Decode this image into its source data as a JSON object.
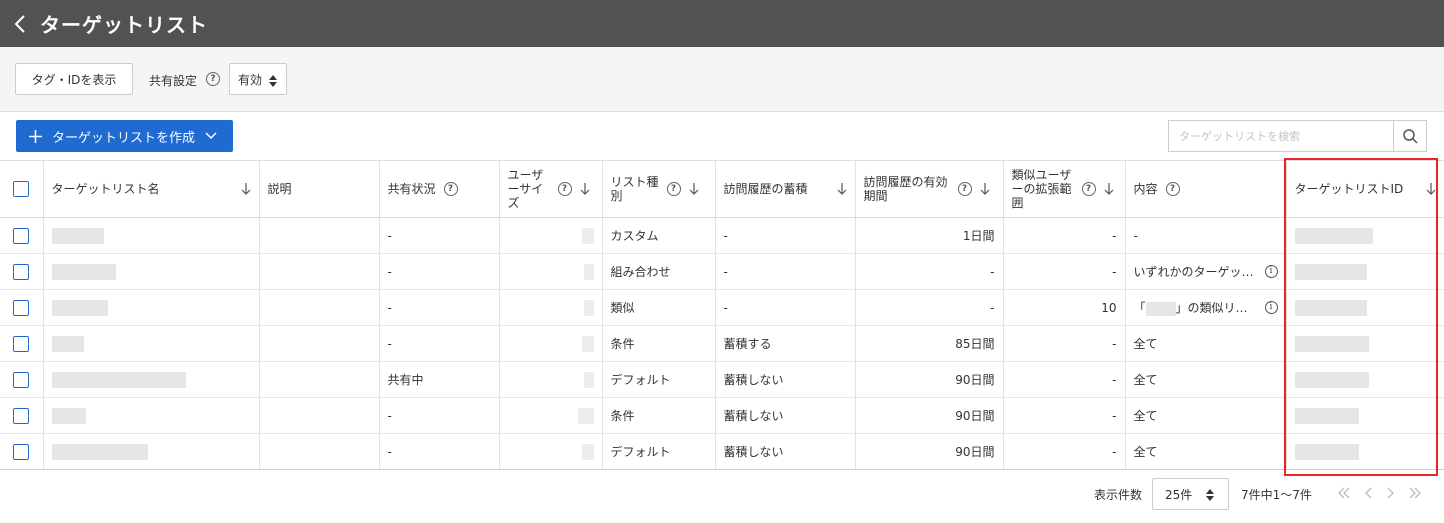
{
  "header": {
    "title": "ターゲットリスト"
  },
  "toolbar": {
    "tag_button": "タグ・IDを表示",
    "share_label": "共有設定",
    "share_value": "有効"
  },
  "actions": {
    "create_button": "ターゲットリストを作成",
    "search_placeholder": "ターゲットリストを検索"
  },
  "table": {
    "columns": {
      "name": "ターゲットリスト名",
      "description": "説明",
      "share_status": "共有状況",
      "user_size": "ユーザーサイズ",
      "list_type": "リスト種別",
      "visit_history": "訪問履歴の蓄積",
      "visit_period": "訪問履歴の有効期間",
      "similar_expansion": "類似ユーザーの拡張範囲",
      "content": "内容",
      "target_id": "ターゲットリストID"
    },
    "rows": [
      {
        "share_status": "-",
        "list_type": "カスタム",
        "visit_history": "-",
        "visit_period": "1日間",
        "similar_expansion": "-",
        "content": "-"
      },
      {
        "share_status": "-",
        "list_type": "組み合わせ",
        "visit_history": "-",
        "visit_period": "-",
        "similar_expansion": "-",
        "content": "いずれかのターゲットリスト",
        "content_display": "いずれかのターゲッ…"
      },
      {
        "share_status": "-",
        "list_type": "類似",
        "visit_history": "-",
        "visit_period": "-",
        "similar_expansion": "10",
        "content_prefix": "「",
        "content_suffix": "」の類似リ…"
      },
      {
        "share_status": "-",
        "list_type": "条件",
        "visit_history": "蓄積する",
        "visit_period": "85日間",
        "similar_expansion": "-",
        "content": "全て"
      },
      {
        "share_status": "共有中",
        "list_type": "デフォルト",
        "visit_history": "蓄積しない",
        "visit_period": "90日間",
        "similar_expansion": "-",
        "content": "全て"
      },
      {
        "share_status": "-",
        "list_type": "条件",
        "visit_history": "蓄積しない",
        "visit_period": "90日間",
        "similar_expansion": "-",
        "content": "全て"
      },
      {
        "share_status": "-",
        "list_type": "デフォルト",
        "visit_history": "蓄積しない",
        "visit_period": "90日間",
        "similar_expansion": "-",
        "content": "全て"
      }
    ]
  },
  "pagination": {
    "per_page_label": "表示件数",
    "per_page_value": "25件",
    "range_text": "7件中1〜7件"
  },
  "colors": {
    "header_bg": "#525252",
    "primary": "#1f6bd1",
    "highlight": "#e8232a"
  },
  "icons": {
    "back": "chevron-left-icon",
    "help": "question-circle-icon",
    "info": "info-circle-icon",
    "search": "search-icon",
    "sort": "arrow-down-icon"
  }
}
